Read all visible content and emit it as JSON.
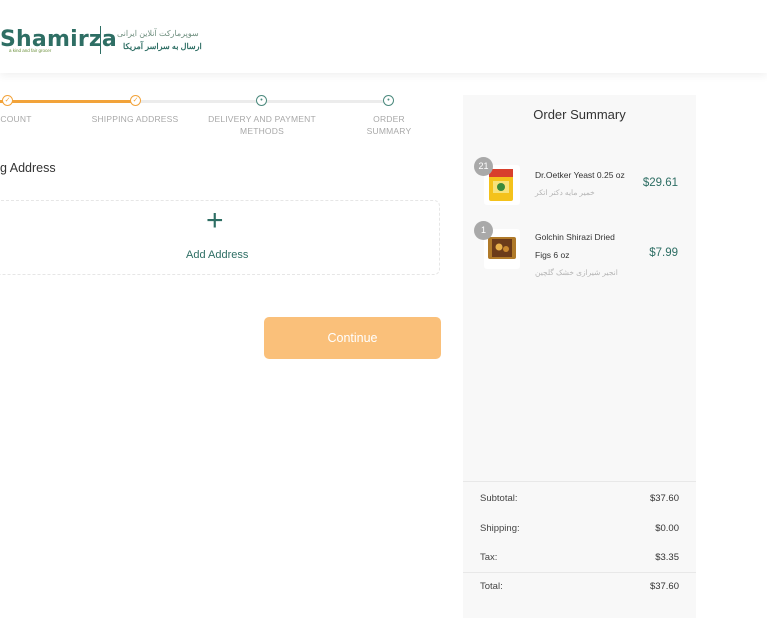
{
  "header": {
    "logo_text": "Shamirza",
    "logo_tagline": "a kind and fair grocer",
    "tagline_fa_1": "سوپرمارکت آنلاین ایرانی",
    "tagline_fa_2": "ارسال به سراسر آمریکا"
  },
  "stepper": {
    "steps": [
      {
        "label_line1": "COUNT",
        "label_line2": "",
        "status": "done",
        "icon": "check-icon"
      },
      {
        "label_line1": "SHIPPING ADDRESS",
        "label_line2": "",
        "status": "done",
        "icon": "check-icon"
      },
      {
        "label_line1": "DELIVERY AND PAYMENT",
        "label_line2": "METHODS",
        "status": "todo",
        "icon": "dot-icon"
      },
      {
        "label_line1": "ORDER",
        "label_line2": "SUMMARY",
        "status": "todo",
        "icon": "dot-icon"
      }
    ],
    "colors": {
      "done": "#f2a33a",
      "todo": "#4c8a7e"
    }
  },
  "main": {
    "section_title": "g Address",
    "add_address_label": "Add Address",
    "continue_label": "Continue"
  },
  "summary": {
    "title": "Order Summary",
    "items": [
      {
        "qty": "21",
        "name_line1": "Dr.Oetker Yeast 0.25 oz",
        "name_line2": "",
        "name_fa": "خمیر مایه دکتر اتکر",
        "price": "$29.61"
      },
      {
        "qty": "1",
        "name_line1": "Golchin Shirazi Dried",
        "name_line2": "Figs 6 oz",
        "name_fa": "انجیر شیرازی خشک گلچین",
        "price": "$7.99"
      }
    ],
    "totals": [
      {
        "label": "Subtotal:",
        "value": "$37.60"
      },
      {
        "label": "Shipping:",
        "value": "$0.00"
      },
      {
        "label": "Tax:",
        "value": "$3.35"
      },
      {
        "label": "Total:",
        "value": "$37.60"
      }
    ]
  },
  "colors": {
    "brand_green": "#2e6e64",
    "accent_orange": "#f2a33a",
    "button_orange": "#fac07a"
  }
}
